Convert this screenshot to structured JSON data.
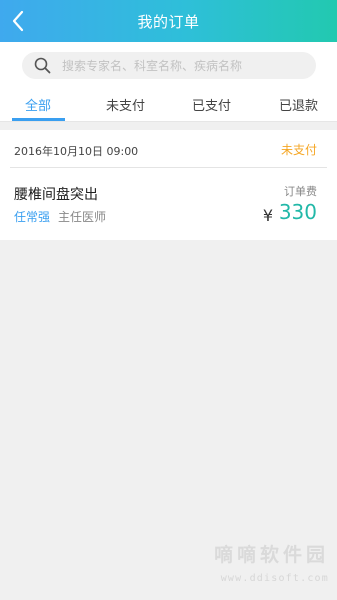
{
  "header": {
    "title": "我的订单",
    "back_icon": "chevron-left-icon"
  },
  "search": {
    "placeholder": "搜索专家名、科室名称、疾病名称",
    "value": "",
    "icon": "search-icon"
  },
  "tabs": [
    {
      "label": "全部",
      "active": true
    },
    {
      "label": "未支付",
      "active": false
    },
    {
      "label": "已支付",
      "active": false
    },
    {
      "label": "已退款",
      "active": false
    }
  ],
  "orders": [
    {
      "datetime": "2016年10月10日  09:00",
      "status": "未支付",
      "diagnosis": "腰椎间盘突出",
      "doctor_name": "任常强",
      "doctor_title": "主任医师",
      "fee_label": "订单费",
      "currency": "¥",
      "amount": "330"
    }
  ],
  "watermark": {
    "text": "嘀嘀软件园",
    "url": "www.ddisoft.com"
  },
  "colors": {
    "header_start": "#3fa9ee",
    "header_end": "#22c9b0",
    "accent": "#3a9ff0",
    "status_unpaid": "#f5a623",
    "price": "#22b8a8"
  }
}
